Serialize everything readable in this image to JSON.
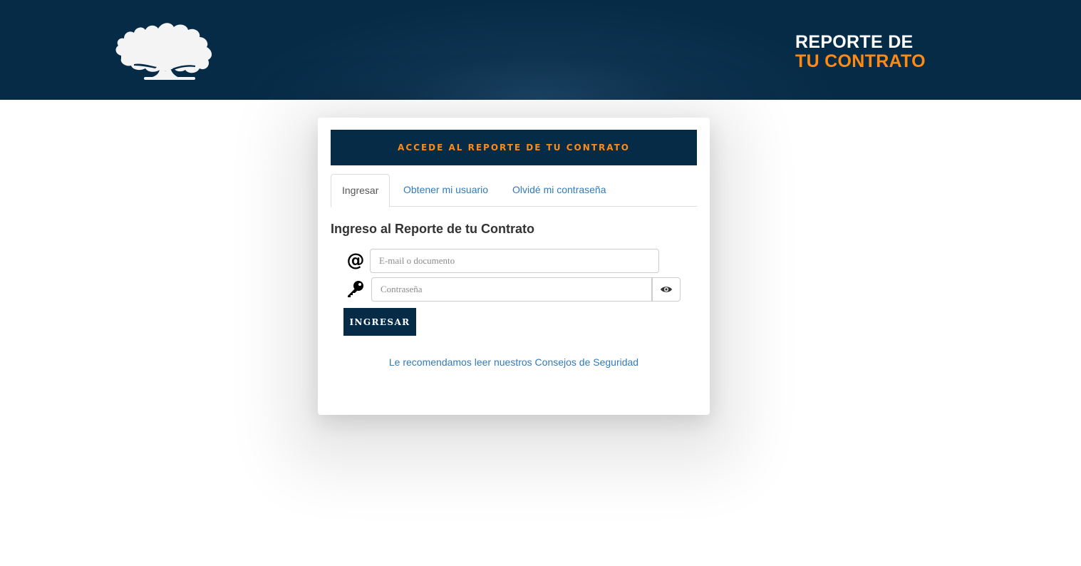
{
  "header": {
    "logo_icon": "tree-logo-icon",
    "brand_line1": "REPORTE DE",
    "brand_line2": "TU CONTRATO",
    "background_color": "#062b47",
    "accent_color": "#ff8a13"
  },
  "card": {
    "heading": "ACCEDE AL REPORTE DE TU CONTRATO",
    "tabs": [
      {
        "label": "Ingresar",
        "active": true
      },
      {
        "label": "Obtener mi usuario",
        "active": false
      },
      {
        "label": "Olvidé mi contraseña",
        "active": false
      }
    ],
    "form_title": "Ingreso al Reporte de tu Contrato",
    "email": {
      "icon": "at-sign-icon",
      "icon_glyph": "@",
      "placeholder": "E-mail o documento",
      "value": ""
    },
    "password": {
      "icon": "key-icon",
      "placeholder": "Contraseña",
      "value": "",
      "toggle_icon": "eye-icon"
    },
    "submit_label": "INGRESAR",
    "security_link": "Le recomendamos leer nuestros Consejos de Seguridad"
  }
}
